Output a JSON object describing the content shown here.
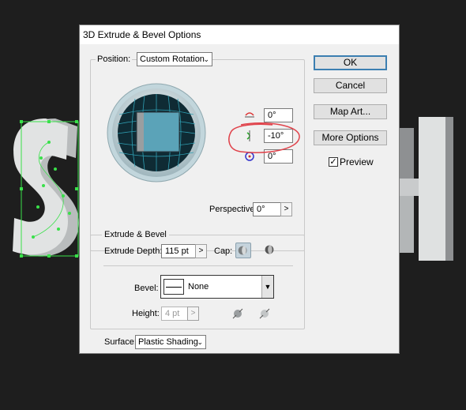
{
  "dialog": {
    "title": "3D Extrude & Bevel Options",
    "buttons": {
      "ok": "OK",
      "cancel": "Cancel",
      "map_art": "Map Art...",
      "more_options": "More Options"
    },
    "preview": {
      "label": "Preview",
      "checked": true,
      "check_mark": "✓"
    }
  },
  "position": {
    "label": "Position:",
    "select_value": "Custom Rotation",
    "rotation": {
      "x_axis": "0°",
      "y_axis": "-10°",
      "z_axis": "0°"
    },
    "perspective_label": "Perspective:",
    "perspective_value": "0°",
    "perspective_arrow": ">"
  },
  "extrude": {
    "group_label": "Extrude & Bevel",
    "depth_label": "Extrude Depth:",
    "depth_value": "115 pt",
    "depth_arrow": ">",
    "cap_label": "Cap:",
    "bevel_label": "Bevel:",
    "bevel_value": "None",
    "height_label": "Height:",
    "height_value": "4 pt",
    "height_arrow": ">"
  },
  "surface": {
    "label": "Surface:",
    "value": "Plastic Shading"
  },
  "colors": {
    "annotation": "#e0434b",
    "selection": "#39e04a",
    "cube_face": "#5ba3b8"
  }
}
